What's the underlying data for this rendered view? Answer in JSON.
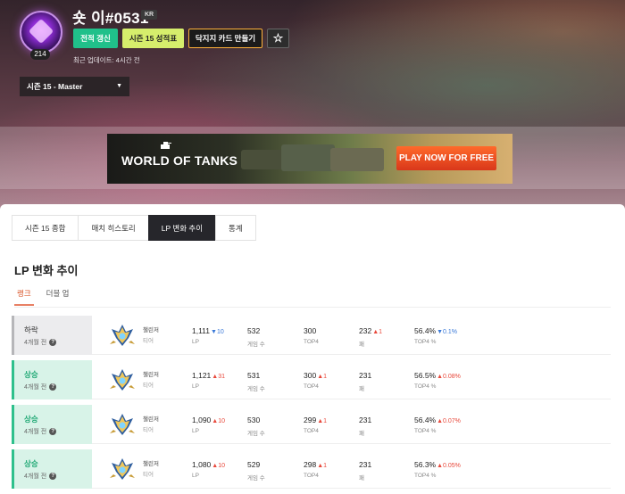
{
  "profile": {
    "name": "숏 이#0531",
    "region": "KR",
    "level": "214",
    "updated": "최근 업데이트: 4시간 전"
  },
  "buttons": {
    "renew": "전적 갱신",
    "season_report": "시즌 15 성적표",
    "card": "닥지지 카드 만들기",
    "favorite": "☆"
  },
  "season_select": {
    "value": "시즌 15 - Master",
    "caret": "▼"
  },
  "ad": {
    "brand": "WORLD OF TANKS",
    "cta": "PLAY NOW FOR FREE"
  },
  "tabs": [
    "시즌 15 종합",
    "매치 히스토리",
    "LP 변화 추이",
    "통계"
  ],
  "active_tab": 2,
  "section_title": "LP 변화 추이",
  "subtabs": [
    "랭크",
    "더블 업"
  ],
  "active_subtab": 0,
  "captions": {
    "tier": "티어",
    "lp": "LP",
    "games": "게임 수",
    "top4": "TOP4",
    "losses": "패",
    "top4_pct": "TOP4 %"
  },
  "rows": [
    {
      "status": "하락",
      "time": "4개월 전",
      "tier": "챌린저",
      "lp": "1,111",
      "lp_chg": "▼10",
      "lp_dir": "down",
      "games": "532",
      "top4": "300",
      "top4_chg": "",
      "top4_dir": "",
      "losses": "232",
      "losses_chg": "▲1",
      "losses_dir": "up",
      "pct": "56.4%",
      "pct_chg": "▼0.1%",
      "pct_dir": "down"
    },
    {
      "status": "상승",
      "time": "4개월 전",
      "tier": "챌린저",
      "lp": "1,121",
      "lp_chg": "▲31",
      "lp_dir": "up",
      "games": "531",
      "top4": "300",
      "top4_chg": "▲1",
      "top4_dir": "up",
      "losses": "231",
      "losses_chg": "",
      "losses_dir": "",
      "pct": "56.5%",
      "pct_chg": "▲0.08%",
      "pct_dir": "up"
    },
    {
      "status": "상승",
      "time": "4개월 전",
      "tier": "챌린저",
      "lp": "1,090",
      "lp_chg": "▲10",
      "lp_dir": "up",
      "games": "530",
      "top4": "299",
      "top4_chg": "▲1",
      "top4_dir": "up",
      "losses": "231",
      "losses_chg": "",
      "losses_dir": "",
      "pct": "56.4%",
      "pct_chg": "▲0.07%",
      "pct_dir": "up"
    },
    {
      "status": "상승",
      "time": "4개월 전",
      "tier": "챌린저",
      "lp": "1,080",
      "lp_chg": "▲10",
      "lp_dir": "up",
      "games": "529",
      "top4": "298",
      "top4_chg": "▲1",
      "top4_dir": "up",
      "losses": "231",
      "losses_chg": "",
      "losses_dir": "",
      "pct": "56.3%",
      "pct_chg": "▲0.05%",
      "pct_dir": "up"
    }
  ],
  "colors": {
    "accent_green": "#20c08a",
    "up_red": "#e8483b",
    "down_blue": "#3a79d8",
    "active_tab_bg": "#26262b"
  },
  "icons": {
    "favorite": "star-icon",
    "help": "question-icon",
    "tier": "challenger-emblem-icon"
  }
}
